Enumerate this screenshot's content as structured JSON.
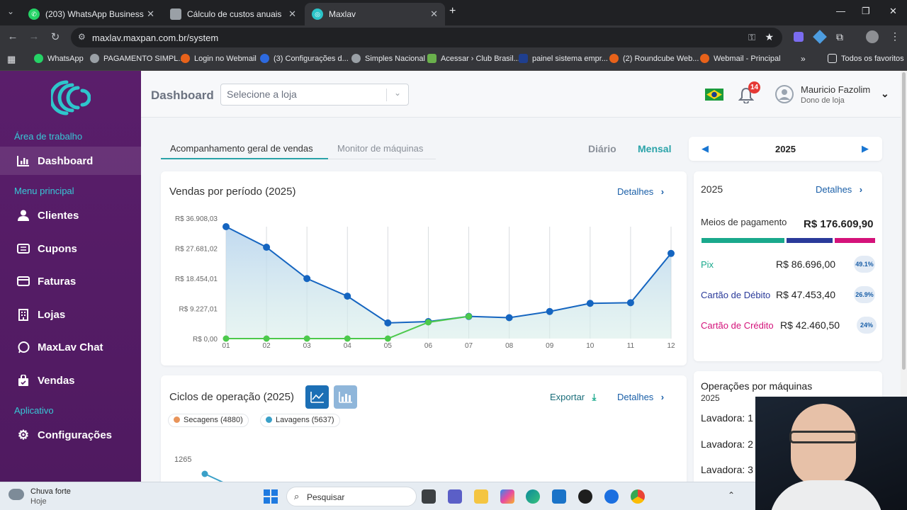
{
  "browser": {
    "tabs": [
      {
        "title": "(203) WhatsApp Business",
        "color": "#25d366"
      },
      {
        "title": "Cálculo de custos anuais",
        "color": "#9aa0a6"
      },
      {
        "title": "Maxlav",
        "color": "#2bc4c9"
      }
    ],
    "url": "maxlav.maxpan.com.br/system",
    "bookmarks": [
      "WhatsApp",
      "PAGAMENTO SIMPL...",
      "Login no Webmail",
      "(3) Configurações d...",
      "Simples Nacional",
      "Acessar › Club Brasil...",
      "painel sistema empr...",
      "(2) Roundcube Web...",
      "Webmail - Principal"
    ],
    "all_bookmarks": "Todos os favoritos"
  },
  "sidebar": {
    "section_workspace": "Área de trabalho",
    "section_main": "Menu principal",
    "section_app": "Aplicativo",
    "items": [
      {
        "label": "Dashboard",
        "icon": "bar-chart-icon"
      },
      {
        "label": "Clientes",
        "icon": "user-icon"
      },
      {
        "label": "Cupons",
        "icon": "coupon-icon"
      },
      {
        "label": "Faturas",
        "icon": "credit-card-icon"
      },
      {
        "label": "Lojas",
        "icon": "building-icon"
      },
      {
        "label": "MaxLav Chat",
        "icon": "whatsapp-icon"
      },
      {
        "label": "Vendas",
        "icon": "shopping-bag-icon"
      },
      {
        "label": "Configurações",
        "icon": "gear-icon"
      }
    ]
  },
  "header": {
    "title": "Dashboard",
    "store_placeholder": "Selecione a loja",
    "notifications": "14",
    "user_name": "Mauricio Fazolim",
    "user_role": "Dono de loja"
  },
  "tabs": {
    "sales": "Acompanhamento geral de vendas",
    "machines": "Monitor de máquinas",
    "daily": "Diário",
    "monthly": "Mensal",
    "year": "2025"
  },
  "sales_chart": {
    "title": "Vendas por período (2025)",
    "details": "Detalhes"
  },
  "payments": {
    "year": "2025",
    "details": "Detalhes",
    "label": "Meios de pagamento",
    "total": "R$ 176.609,90",
    "items": [
      {
        "name": "Pix",
        "value": "R$ 86.696,00",
        "pct": "49.1%",
        "share": 0.491,
        "color": "#1aa98c"
      },
      {
        "name": "Cartão de Débito",
        "value": "R$ 47.453,40",
        "pct": "26.9%",
        "share": 0.269,
        "color": "#2a3a9a"
      },
      {
        "name": "Cartão de Crédito",
        "value": "R$ 42.460,50",
        "pct": "24%",
        "share": 0.24,
        "color": "#d4127a"
      }
    ]
  },
  "cycles": {
    "title": "Ciclos de operação (2025)",
    "export": "Exportar",
    "details": "Detalhes",
    "legend": [
      "Secagens (4880)",
      "Lavagens (5637)"
    ],
    "legend_colors": [
      "#e8945a",
      "#3aa0c8"
    ],
    "y_tick": "1265"
  },
  "machines_ops": {
    "title": "Operações por máquinas",
    "year": "2025",
    "rows": [
      "Lavadora: 1",
      "Lavadora: 2",
      "Lavadora: 3"
    ]
  },
  "taskbar": {
    "weather": "Chuva forte",
    "weather_sub": "Hoje",
    "search": "Pesquisar"
  },
  "chart_data": {
    "type": "line",
    "title": "Vendas por período (2025)",
    "categories": [
      "01",
      "02",
      "03",
      "04",
      "05",
      "06",
      "07",
      "08",
      "09",
      "10",
      "11",
      "12"
    ],
    "y_ticks": [
      "R$ 0,00",
      "R$ 9.227,01",
      "R$ 18.454,01",
      "R$ 27.681,02",
      "R$ 36.908,03"
    ],
    "ylim": [
      0,
      36908.03
    ],
    "grid": true,
    "series": [
      {
        "color": "#1565c0",
        "values": [
          34300,
          28000,
          18400,
          13000,
          4800,
          5200,
          6800,
          6400,
          8300,
          10800,
          11000,
          26100
        ]
      },
      {
        "color": "#4cc94c",
        "values": [
          0,
          0,
          0,
          0,
          0,
          5000,
          6800,
          null,
          null,
          null,
          null,
          null
        ]
      }
    ]
  }
}
